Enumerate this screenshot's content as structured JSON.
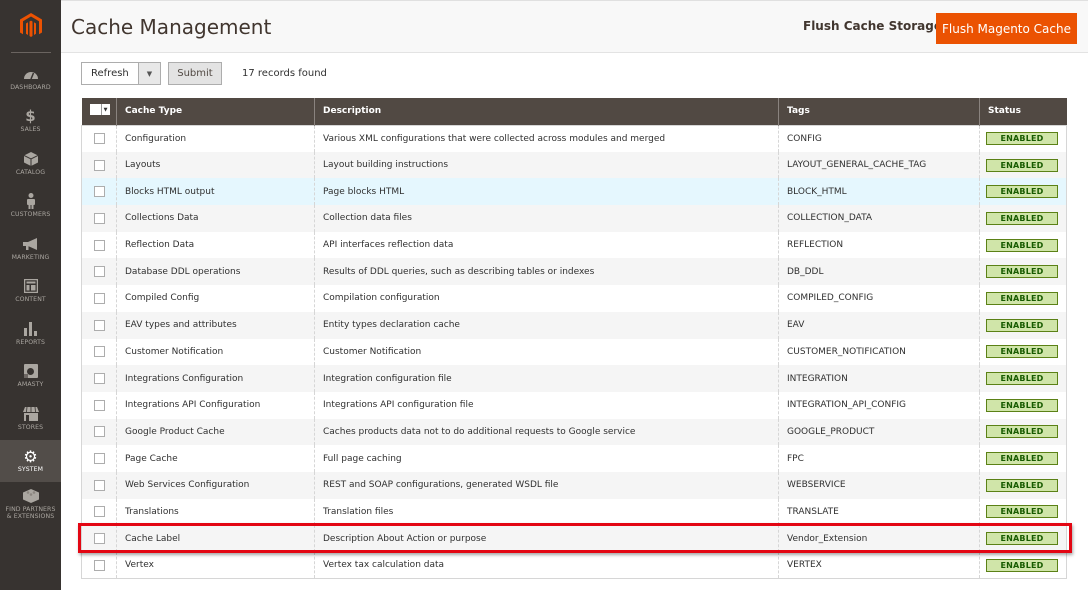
{
  "sidebar": {
    "logo": "magento-logo",
    "items": [
      {
        "label": "DASHBOARD",
        "icon": "dashboard-icon",
        "active": false
      },
      {
        "label": "SALES",
        "icon": "dollar-icon",
        "active": false
      },
      {
        "label": "CATALOG",
        "icon": "box-icon",
        "active": false
      },
      {
        "label": "CUSTOMERS",
        "icon": "person-icon",
        "active": false
      },
      {
        "label": "MARKETING",
        "icon": "megaphone-icon",
        "active": false
      },
      {
        "label": "CONTENT",
        "icon": "layout-icon",
        "active": false
      },
      {
        "label": "REPORTS",
        "icon": "bar-chart-icon",
        "active": false
      },
      {
        "label": "AMASTY",
        "icon": "amasty-icon",
        "active": false
      },
      {
        "label": "STORES",
        "icon": "storefront-icon",
        "active": false
      },
      {
        "label": "SYSTEM",
        "icon": "gear-icon",
        "active": true
      },
      {
        "label": "FIND PARTNERS & EXTENSIONS",
        "icon": "blocks-icon",
        "active": false
      }
    ]
  },
  "header": {
    "title": "Cache Management",
    "flush_storage_label": "Flush Cache Storage",
    "flush_magento_label": "Flush Magento Cache"
  },
  "toolbar": {
    "action_value": "Refresh",
    "submit_label": "Submit",
    "records_text": "17 records found"
  },
  "table": {
    "columns": [
      "",
      "Cache Type",
      "Description",
      "Tags",
      "Status"
    ],
    "rows": [
      {
        "type": "Configuration",
        "description": "Various XML configurations that were collected across modules and merged",
        "tags": "CONFIG",
        "status": "ENABLED"
      },
      {
        "type": "Layouts",
        "description": "Layout building instructions",
        "tags": "LAYOUT_GENERAL_CACHE_TAG",
        "status": "ENABLED"
      },
      {
        "type": "Blocks HTML output",
        "description": "Page blocks HTML",
        "tags": "BLOCK_HTML",
        "status": "ENABLED"
      },
      {
        "type": "Collections Data",
        "description": "Collection data files",
        "tags": "COLLECTION_DATA",
        "status": "ENABLED"
      },
      {
        "type": "Reflection Data",
        "description": "API interfaces reflection data",
        "tags": "REFLECTION",
        "status": "ENABLED"
      },
      {
        "type": "Database DDL operations",
        "description": "Results of DDL queries, such as describing tables or indexes",
        "tags": "DB_DDL",
        "status": "ENABLED"
      },
      {
        "type": "Compiled Config",
        "description": "Compilation configuration",
        "tags": "COMPILED_CONFIG",
        "status": "ENABLED"
      },
      {
        "type": "EAV types and attributes",
        "description": "Entity types declaration cache",
        "tags": "EAV",
        "status": "ENABLED"
      },
      {
        "type": "Customer Notification",
        "description": "Customer Notification",
        "tags": "CUSTOMER_NOTIFICATION",
        "status": "ENABLED"
      },
      {
        "type": "Integrations Configuration",
        "description": "Integration configuration file",
        "tags": "INTEGRATION",
        "status": "ENABLED"
      },
      {
        "type": "Integrations API Configuration",
        "description": "Integrations API configuration file",
        "tags": "INTEGRATION_API_CONFIG",
        "status": "ENABLED"
      },
      {
        "type": "Google Product Cache",
        "description": "Caches products data not to do additional requests to Google service",
        "tags": "GOOGLE_PRODUCT",
        "status": "ENABLED"
      },
      {
        "type": "Page Cache",
        "description": "Full page caching",
        "tags": "FPC",
        "status": "ENABLED"
      },
      {
        "type": "Web Services Configuration",
        "description": "REST and SOAP configurations, generated WSDL file",
        "tags": "WEBSERVICE",
        "status": "ENABLED"
      },
      {
        "type": "Translations",
        "description": "Translation files",
        "tags": "TRANSLATE",
        "status": "ENABLED"
      },
      {
        "type": "Cache Label",
        "description": "Description About Action or purpose",
        "tags": "Vendor_Extension",
        "status": "ENABLED"
      },
      {
        "type": "Vertex",
        "description": "Vertex tax calculation data",
        "tags": "VERTEX",
        "status": "ENABLED"
      }
    ]
  },
  "colors": {
    "brand": "#eb5202",
    "sidebar_bg": "#373330",
    "table_header_bg": "#514943",
    "enabled_bg": "#d0e5a9",
    "enabled_text": "#185b00",
    "highlight_border": "#e30613",
    "hover_row": "#e5f7fe"
  }
}
